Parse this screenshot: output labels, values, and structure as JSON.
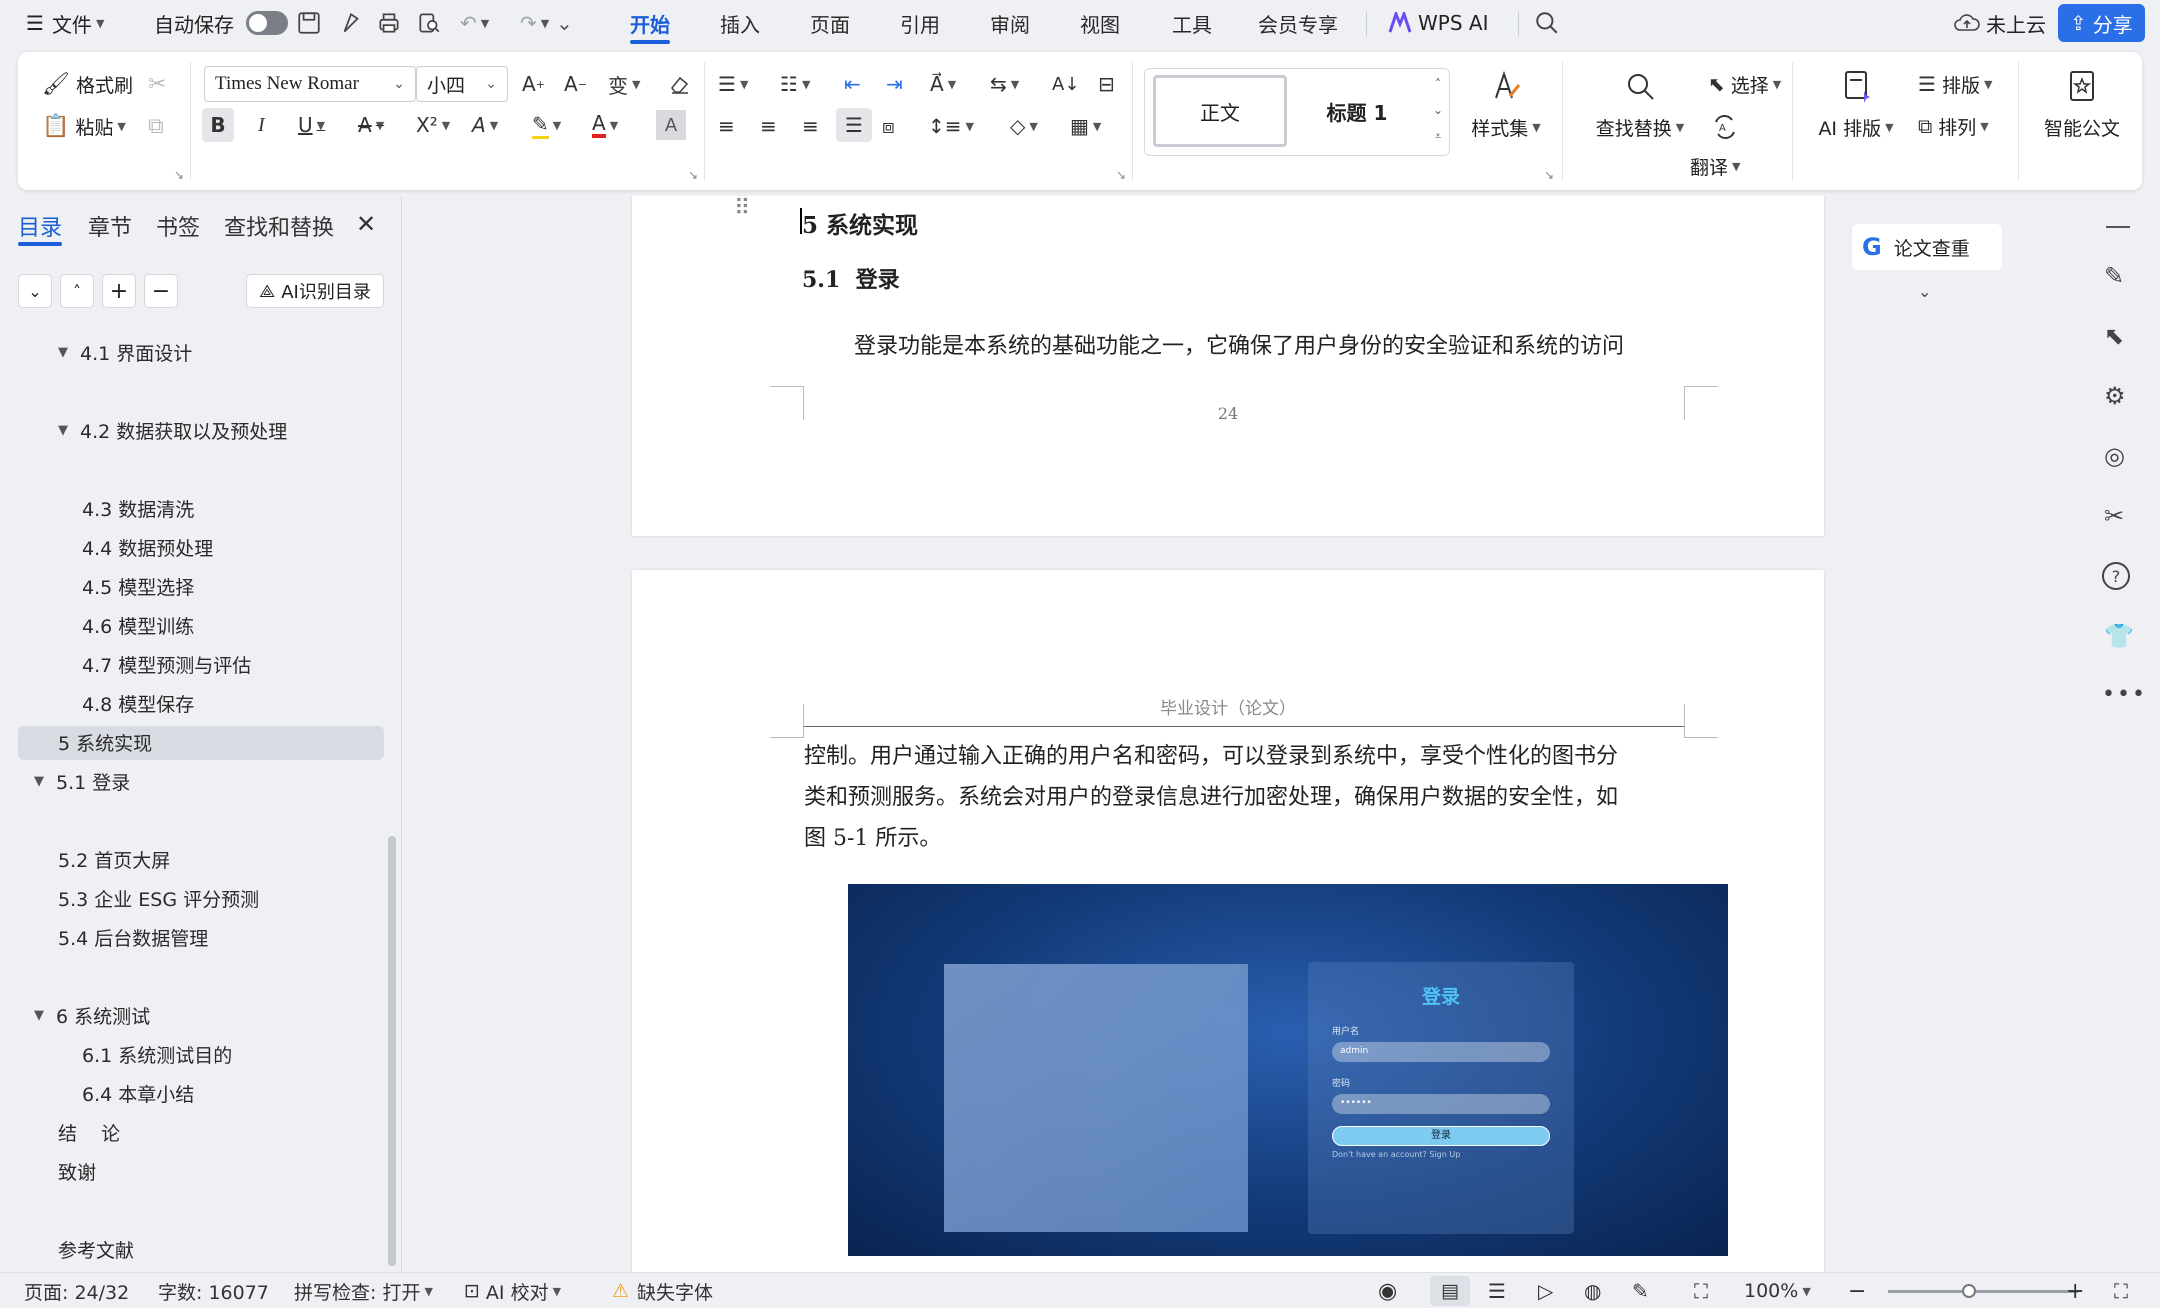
{
  "menubar": {
    "file": "文件",
    "autosave": "自动保存",
    "tabs": [
      "开始",
      "插入",
      "页面",
      "引用",
      "审阅",
      "视图",
      "工具",
      "会员专享"
    ],
    "wps_ai": "WPS AI",
    "cloud": "未上云",
    "share": "分享"
  },
  "ribbon": {
    "format_painter": "格式刷",
    "paste": "粘贴",
    "font_name": "Times New Romar",
    "font_size": "小四",
    "style_normal": "正文",
    "style_heading": "标题 1",
    "style_set": "样式集",
    "find_replace": "查找替换",
    "select": "选择",
    "translate": "翻译",
    "ai_layout": "AI 排版",
    "layout": "排版",
    "arrange": "排列",
    "smart_doc": "智能公文"
  },
  "sidebar": {
    "tabs": [
      "目录",
      "章节",
      "书签",
      "查找和替换"
    ],
    "ai_toc": "AI识别目录",
    "toc": [
      {
        "label": "4.1  界面设计",
        "expanded": true
      },
      {
        "label": "4.2 数据获取以及预处理",
        "expanded": true
      },
      {
        "label": "4.3 数据清洗"
      },
      {
        "label": "4.4  数据预处理"
      },
      {
        "label": "4.5  模型选择"
      },
      {
        "label": "4.6  模型训练"
      },
      {
        "label": "4.7  模型预测与评估"
      },
      {
        "label": "4.8  模型保存"
      },
      {
        "label": "5 系统实现",
        "selected": true
      },
      {
        "label": "5.1  登录",
        "expanded": true
      },
      {
        "label": "5.2  首页大屏"
      },
      {
        "label": "5.3  企业 ESG 评分预测"
      },
      {
        "label": "5.4  后台数据管理"
      },
      {
        "label": "6  系统测试",
        "expanded": true
      },
      {
        "label": "6.1  系统测试目的"
      },
      {
        "label": "6.4  本章小结"
      },
      {
        "label": "结    论"
      },
      {
        "label": "致谢"
      },
      {
        "label": "参考文献"
      }
    ]
  },
  "document": {
    "h1": "5 系统实现",
    "h2": "5.1  登录",
    "para1": "登录功能是本系统的基础功能之一，它确保了用户身份的安全验证和系统的访问",
    "page_number": "24",
    "header": "毕业设计（论文）",
    "para2_lines": [
      "控制。用户通过输入正确的用户名和密码，可以登录到系统中，享受个性化的图书分",
      "类和预测服务。系统会对用户的登录信息进行加密处理，确保用户数据的安全性，如",
      "图 5-1 所示。"
    ],
    "figure": {
      "title": "登录",
      "username_label": "用户名",
      "username_value": "admin",
      "password_label": "密码",
      "password_value": "••••••",
      "button": "登录",
      "signup": "Don't have an account? Sign Up"
    }
  },
  "right_panel": {
    "paper_check": "论文查重"
  },
  "status": {
    "page": "页面: 24/32",
    "words": "字数: 16077",
    "spell": "拼写检查: 打开",
    "ai_proof": "AI 校对",
    "missing_font": "缺失字体",
    "zoom": "100%"
  },
  "colors": {
    "accent": "#1a5fd8",
    "share_button": "#2a6fe8",
    "figure_bg": "#123a78",
    "login_title": "#4fc3f7"
  }
}
